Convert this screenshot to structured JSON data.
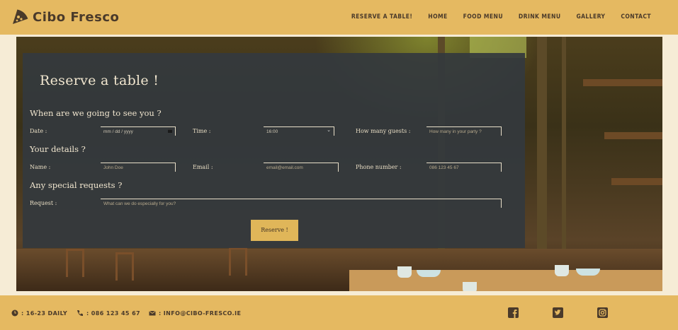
{
  "brand": {
    "name": "Cibo Fresco",
    "icon": "pizza-slice-icon"
  },
  "nav": {
    "items": [
      {
        "label": "RESERVE A TABLE!"
      },
      {
        "label": "HOME"
      },
      {
        "label": "FOOD MENU"
      },
      {
        "label": "DRINK MENU"
      },
      {
        "label": "GALLERY"
      },
      {
        "label": "CONTACT"
      }
    ]
  },
  "form": {
    "title": "Reserve a table !",
    "sections": {
      "when": "When are we going to see you ?",
      "details": "Your details ?",
      "requests": "Any special requests ?"
    },
    "fields": {
      "date": {
        "label": "Date :",
        "value": "mm / dd / yyyy"
      },
      "time": {
        "label": "Time :",
        "value": "16:00"
      },
      "guests": {
        "label": "How many guests :",
        "placeholder": "How many in your party ?"
      },
      "name": {
        "label": "Name :",
        "placeholder": "John Doe"
      },
      "email": {
        "label": "Email :",
        "placeholder": "email@email.com"
      },
      "phone": {
        "label": "Phone number :",
        "placeholder": "086 123 45 67"
      },
      "request": {
        "label": "Request :",
        "placeholder": "What can we do especially for you?"
      }
    },
    "submit_label": "Reserve !"
  },
  "footer": {
    "hours": {
      "icon": "clock-icon",
      "text": ": 16-23 DAILY"
    },
    "phone": {
      "icon": "phone-icon",
      "text": ": 086 123 45 67"
    },
    "email": {
      "icon": "envelope-icon",
      "text": ": INFO@CIBO-FRESCO.IE"
    },
    "social": [
      "facebook-icon",
      "twitter-icon",
      "instagram-icon"
    ]
  },
  "colors": {
    "accent": "#e5b961",
    "panel": "#34393d",
    "text_dark": "#4a3a2a",
    "cream": "#f6ecd6"
  }
}
